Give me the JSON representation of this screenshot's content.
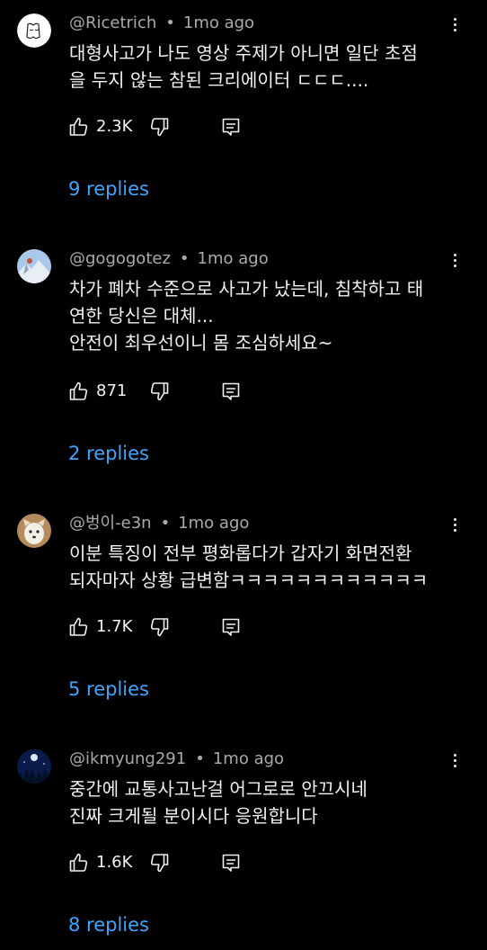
{
  "comments": [
    {
      "author": "@Ricetrich",
      "time": "1mo ago",
      "text_lines": [
        "대형사고가 나도 영상 주제가 아니면 일단 초점",
        "을 두지 않는 참된 크리에이터 ㄷㄷㄷ...."
      ],
      "likes": "2.3K",
      "replies": "9 replies"
    },
    {
      "author": "@gogogotez",
      "time": "1mo ago",
      "text_lines": [
        "차가 폐차 수준으로 사고가 났는데, 침착하고 태",
        "연한 당신은 대체...",
        "안전이 최우선이니 몸 조심하세요~"
      ],
      "likes": "871",
      "replies": "2 replies"
    },
    {
      "author": "@벙이-e3n",
      "time": "1mo ago",
      "text_lines": [
        "이분 특징이 전부 평화롭다가 갑자기 화면전환",
        "되자마자 상황 급변함ㅋㅋㅋㅋㅋㅋㅋㅋㅋㅋㅋㅋ"
      ],
      "likes": "1.7K",
      "replies": "5 replies"
    },
    {
      "author": "@ikmyung291",
      "time": "1mo ago",
      "text_lines": [
        "중간에 교통사고난걸 어그로로 안끄시네",
        "진짜 크게될 분이시다 응원합니다"
      ],
      "likes": "1.6K",
      "replies": "8 replies"
    }
  ],
  "colors": {
    "background": "#000000",
    "text": "#f1f1f1",
    "meta": "#aaaaaa",
    "link": "#3ea6ff"
  },
  "icons": [
    "more-vert-icon",
    "thumb-up-icon",
    "thumb-down-icon",
    "reply-icon"
  ]
}
